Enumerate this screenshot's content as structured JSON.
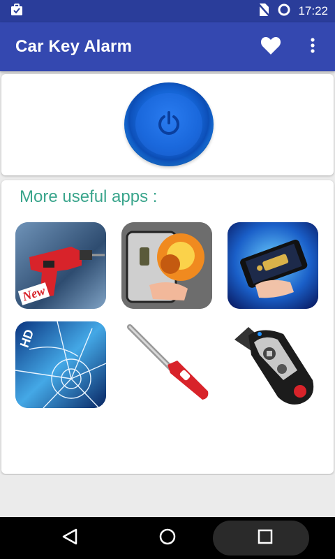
{
  "status_bar": {
    "time": "17:22",
    "icons": [
      "briefcase-check-icon",
      "no-sim-icon",
      "sync-circle-icon"
    ]
  },
  "app_bar": {
    "title": "Car Key Alarm",
    "actions": [
      "heart-icon",
      "more-vert-icon"
    ]
  },
  "power_card": {
    "icon": "power-icon"
  },
  "apps_section": {
    "heading": "More useful apps :",
    "apps": [
      {
        "icon": "drill-app-icon",
        "badge": "New"
      },
      {
        "icon": "grenade-app-icon",
        "badge": ""
      },
      {
        "icon": "flashlight-phone-app-icon",
        "badge": ""
      },
      {
        "icon": "broken-glass-app-icon",
        "badge": "HD"
      },
      {
        "icon": "lighter-app-icon",
        "badge": ""
      },
      {
        "icon": "car-key-remote-app-icon",
        "badge": ""
      }
    ]
  },
  "nav_bar": {
    "buttons": [
      "back-icon",
      "home-icon",
      "recents-icon"
    ]
  },
  "colors": {
    "status_bar": "#2a3d9a",
    "app_bar": "#3448b0",
    "accent_heading": "#3aa58c",
    "power_blue": "#1565d6"
  }
}
